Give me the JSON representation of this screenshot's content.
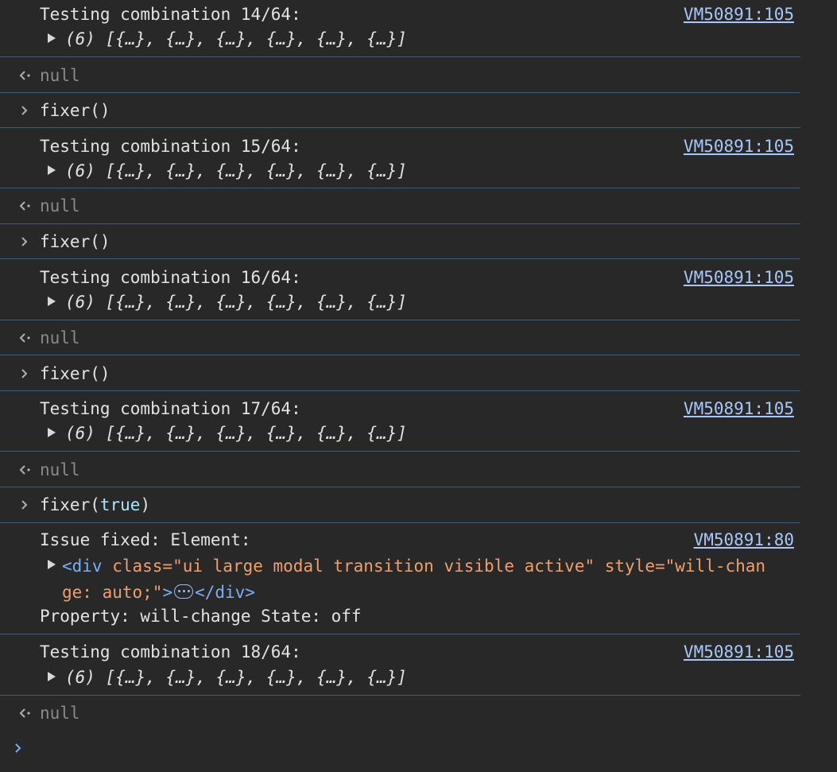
{
  "entries": [
    {
      "kind": "log",
      "message": "Testing combination 14/64:",
      "source": "VM50891:105",
      "preview_count": "(6)",
      "preview": "[{…}, {…}, {…}, {…}, {…}, {…}]"
    },
    {
      "kind": "result",
      "value": "null"
    },
    {
      "kind": "input",
      "command": "fixer()"
    },
    {
      "kind": "log",
      "message": "Testing combination 15/64:",
      "source": "VM50891:105",
      "preview_count": "(6)",
      "preview": "[{…}, {…}, {…}, {…}, {…}, {…}]"
    },
    {
      "kind": "result",
      "value": "null"
    },
    {
      "kind": "input",
      "command": "fixer()"
    },
    {
      "kind": "log",
      "message": "Testing combination 16/64:",
      "source": "VM50891:105",
      "preview_count": "(6)",
      "preview": "[{…}, {…}, {…}, {…}, {…}, {…}]"
    },
    {
      "kind": "result",
      "value": "null"
    },
    {
      "kind": "input",
      "command": "fixer()"
    },
    {
      "kind": "log",
      "message": "Testing combination 17/64:",
      "source": "VM50891:105",
      "preview_count": "(6)",
      "preview": "[{…}, {…}, {…}, {…}, {…}, {…}]"
    },
    {
      "kind": "result",
      "value": "null"
    },
    {
      "kind": "input",
      "command_fn": "fixer(",
      "command_arg": "true",
      "command_close": ")"
    },
    {
      "kind": "issue",
      "message": "Issue fixed: Element:",
      "source": "VM50891:80",
      "element": {
        "open_tag": "<div",
        "attr1_name": " class=",
        "attr1_value": "\"ui large modal transition visible active\"",
        "attr2_name": " style=",
        "attr2_value_line1": "\"will-chan",
        "attr2_value_line2": "ge: auto;\"",
        "close_bracket": ">",
        "end_tag": "</div>"
      },
      "property_line": "Property: will-change State: off"
    },
    {
      "kind": "log",
      "message": "Testing combination 18/64:",
      "source": "VM50891:105",
      "preview_count": "(6)",
      "preview": "[{…}, {…}, {…}, {…}, {…}, {…}]"
    },
    {
      "kind": "result",
      "value": "null"
    }
  ],
  "icons": {
    "input_prompt": "chevron-right-icon",
    "result_marker": "return-arrow-icon",
    "expander": "triangle-right-icon",
    "ellipsis": "ellipsis-pill-icon",
    "active_prompt": "chevron-right-icon"
  },
  "colors": {
    "background": "#282828",
    "separator": "#3d5a80",
    "link": "#a8c7fa",
    "null_text": "#8a8a8a",
    "tag": "#7cacf8",
    "attribute": "#ee9f6f",
    "prompt": "#7cacf8"
  }
}
